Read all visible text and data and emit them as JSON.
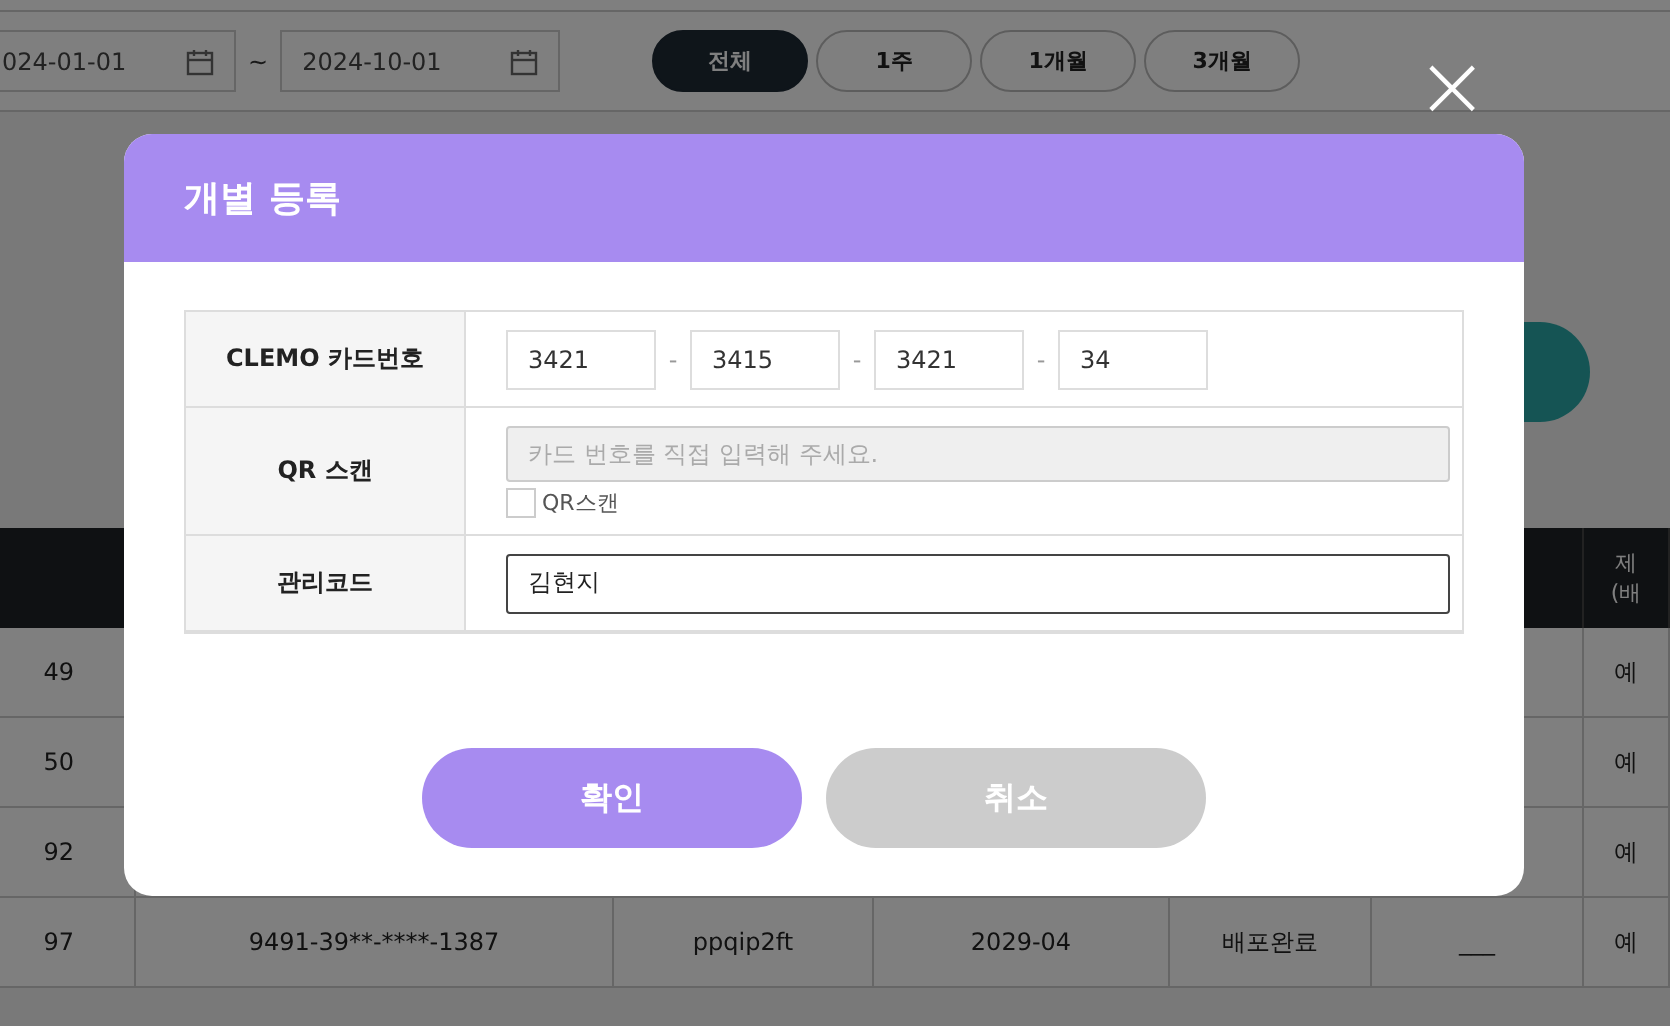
{
  "filter": {
    "date_from": "024-01-01",
    "separator": "~",
    "date_to": "2024-10-01",
    "periods": [
      {
        "label": "전체",
        "selected": true
      },
      {
        "label": "1주",
        "selected": false
      },
      {
        "label": "1개월",
        "selected": false
      },
      {
        "label": "3개월",
        "selected": false
      }
    ]
  },
  "table": {
    "columns": [
      "",
      "",
      "",
      "",
      "",
      "",
      "제\n(배"
    ],
    "rows": [
      [
        "49",
        "",
        "",
        "",
        "",
        "",
        "예"
      ],
      [
        "50",
        "",
        "",
        "",
        "",
        "",
        "예"
      ],
      [
        "92",
        "",
        "",
        "",
        "",
        "",
        "예"
      ],
      [
        "97",
        "9491-39**-****-1387",
        "ppqip2ft",
        "2029-04",
        "배포완료",
        "___",
        "예"
      ]
    ]
  },
  "modal": {
    "title": "개별 등록",
    "close": "×",
    "fields": [
      {
        "kind": "card",
        "label": "CLEMO 카드번호",
        "parts": [
          "3421",
          "3415",
          "3421",
          "34"
        ],
        "separator": "-"
      },
      {
        "kind": "qr",
        "label": "QR 스캔",
        "placeholder": "카드 번호를 직접 입력해 주세요.",
        "checkbox": {
          "label": "QR스캔",
          "checked": false
        }
      },
      {
        "kind": "text",
        "label": "관리코드",
        "value": "김현지"
      }
    ],
    "buttons": [
      {
        "label": "확인",
        "kind": "primary"
      },
      {
        "label": "취소",
        "kind": "secondary"
      }
    ]
  }
}
